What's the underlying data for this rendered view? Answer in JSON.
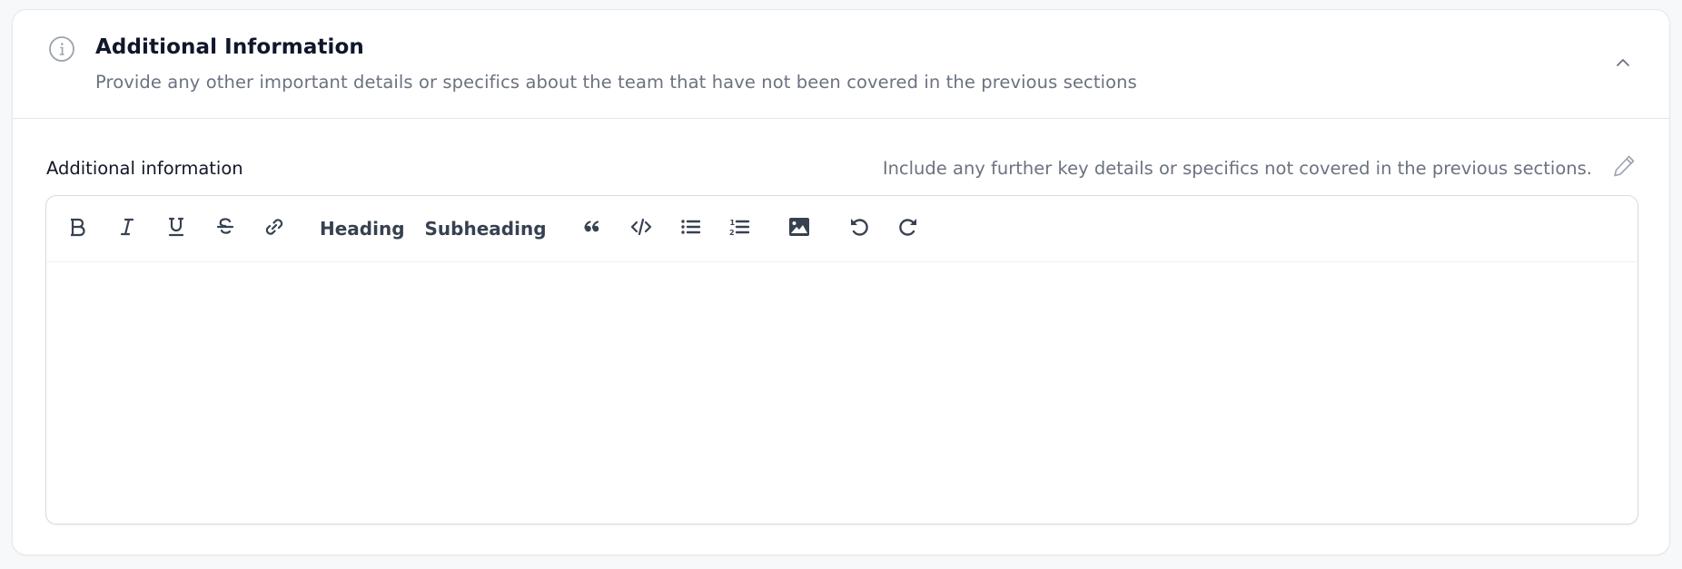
{
  "section": {
    "icon": "info-circle-icon",
    "title": "Additional Information",
    "subtitle": "Provide any other important details or specifics about the team that have not been covered in the previous sections",
    "collapse_icon": "chevron-up-icon",
    "expanded": true
  },
  "field": {
    "label": "Additional information",
    "hint": "Include any further key details or specifics not covered in the previous sections.",
    "edit_icon": "pencil-icon",
    "value": ""
  },
  "toolbar": {
    "items": [
      {
        "name": "bold",
        "icon": "bold-icon"
      },
      {
        "name": "italic",
        "icon": "italic-icon"
      },
      {
        "name": "underline",
        "icon": "underline-icon"
      },
      {
        "name": "strikethrough",
        "icon": "strikethrough-icon"
      },
      {
        "name": "link",
        "icon": "link-icon"
      },
      {
        "name": "heading",
        "label": "Heading"
      },
      {
        "name": "subheading",
        "label": "Subheading"
      },
      {
        "name": "blockquote",
        "icon": "quote-icon"
      },
      {
        "name": "code",
        "icon": "code-icon"
      },
      {
        "name": "bullet-list",
        "icon": "bullet-list-icon"
      },
      {
        "name": "ordered-list",
        "icon": "ordered-list-icon"
      },
      {
        "name": "image",
        "icon": "image-icon"
      },
      {
        "name": "undo",
        "icon": "undo-icon"
      },
      {
        "name": "redo",
        "icon": "redo-icon"
      }
    ]
  },
  "colors": {
    "title": "#0f172a",
    "muted": "#6b7280",
    "icon": "#374151",
    "border": "#e5e7eb",
    "page_bg": "#f7f8fa"
  }
}
